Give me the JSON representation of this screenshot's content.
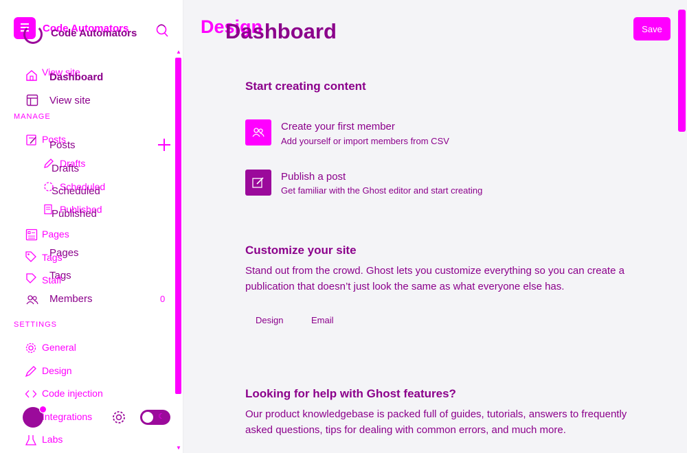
{
  "sidebar": {
    "brand_a": "Code Automators",
    "brand_b": "Code Automators",
    "overlay_view_site": "View site",
    "dashboard": "Dashboard",
    "view_site": "View site",
    "section_manage": "MANAGE",
    "posts_a": "Posts",
    "posts_b": "Posts",
    "drafts_a": "Drafts",
    "drafts_b": "Drafts",
    "scheduled_a": "Scheduled",
    "scheduled_b": "Scheduled",
    "published_a": "Published",
    "published_b": "Published",
    "pages_a": "Pages",
    "pages_b": "Pages",
    "tags_a": "Tags",
    "tags_b": "Tags",
    "staff_a": "Staff",
    "members": "Members",
    "members_count": "0",
    "section_settings": "SETTINGS",
    "general": "General",
    "design": "Design",
    "code_injection": "Code injection",
    "integrations": "Integrations",
    "labs": "Labs"
  },
  "header": {
    "title_a": "Design",
    "title_b": "Dashboard",
    "save_label": "Save"
  },
  "content": {
    "start_heading": "Start creating content",
    "cards": [
      {
        "title": "Create your first member",
        "subtitle": "Add yourself or import members from CSV"
      },
      {
        "title": "Publish a post",
        "subtitle": "Get familiar with the Ghost editor and start creating"
      }
    ],
    "customize_heading": "Customize your site",
    "customize_text": "Stand out from the crowd. Ghost lets you customize everything so you can create a publication that doesn’t just look the same as what everyone else has.",
    "customize_links": [
      "Design",
      "Email"
    ],
    "help_heading": "Looking for help with Ghost features?",
    "help_text": "Our product knowledgebase is packed full of guides, tutorials, answers to frequently asked questions, tips for dealing with common errors, and much more."
  },
  "colors": {
    "accent": "#ff00ff",
    "accent_dark": "#9b0a9b",
    "text": "#8b008b",
    "background": "#f4f4f7"
  }
}
